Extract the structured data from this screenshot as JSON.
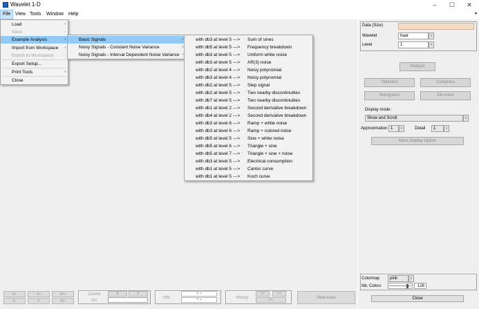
{
  "window": {
    "title": "Wavelet 1-D",
    "minimize": "–",
    "maximize": "☐",
    "close": "✕"
  },
  "menubar": {
    "items": [
      "File",
      "View",
      "Tools",
      "Window",
      "Help"
    ],
    "overflow_arrow": "▾"
  },
  "file_menu": {
    "items": [
      {
        "label": "Load",
        "disabled": false,
        "submenu": true
      },
      {
        "label": "Save",
        "disabled": true,
        "submenu": true
      },
      {
        "label": "Example Analysis",
        "disabled": false,
        "submenu": true,
        "highlighted": true
      },
      {
        "label": "Import from Workspace",
        "disabled": false,
        "submenu": true
      },
      {
        "label": "Export to Workspace",
        "disabled": true,
        "submenu": true
      },
      {
        "label": "Export Setup...",
        "disabled": false,
        "submenu": false
      },
      {
        "label": "Print Tools",
        "disabled": false,
        "submenu": true
      },
      {
        "label": "Close",
        "disabled": false,
        "submenu": false
      }
    ],
    "submenu_arrow": "›"
  },
  "example_menu": {
    "items": [
      {
        "label": "Basic Signals",
        "highlighted": true
      },
      {
        "label": "Noisy Signals - Constant Noise Variance",
        "highlighted": false
      },
      {
        "label": "Noisy Signals - Interval Dependent Noise Variance",
        "highlighted": false
      }
    ],
    "submenu_arrow": "›"
  },
  "basic_signals": [
    {
      "prefix": "with db3 at level 5 --->",
      "name": "Sum of sines"
    },
    {
      "prefix": "with db5 at level 5 --->",
      "name": "Frequency breakdown"
    },
    {
      "prefix": "with db3 at level 5 --->",
      "name": "Uniform white noise"
    },
    {
      "prefix": "with db3 at level 5 --->",
      "name": "AR(3) noise"
    },
    {
      "prefix": "with db2 at level 4 --->",
      "name": "Noisy polynomial"
    },
    {
      "prefix": "with db3 at level 4 --->",
      "name": "Noisy polynomial"
    },
    {
      "prefix": "with db2 at level 5 --->",
      "name": "Step signal"
    },
    {
      "prefix": "with db2 at level 5 --->",
      "name": "Two nearby discontinuities"
    },
    {
      "prefix": "with db7 at level 5 --->",
      "name": "Two nearby discontinuities"
    },
    {
      "prefix": "with db1 at level 2 --->",
      "name": "Second derivative breakdown"
    },
    {
      "prefix": "with db4 at level 2 --->",
      "name": "Second derivative breakdown"
    },
    {
      "prefix": "with db3 at level 6 --->",
      "name": "Ramp + white noise"
    },
    {
      "prefix": "with db3 at level 6 --->",
      "name": "Ramp + colored noise"
    },
    {
      "prefix": "with db5 at level 5 --->",
      "name": "Sine + white noise"
    },
    {
      "prefix": "with db5 at level 6 --->",
      "name": "Triangle + sine"
    },
    {
      "prefix": "with db5 at level 7 --->",
      "name": "Triangle + sine + noise"
    },
    {
      "prefix": "with db3 at level 5 --->",
      "name": "Electrical consumption"
    },
    {
      "prefix": "with db1 at level 5 --->",
      "name": "Cantor curve"
    },
    {
      "prefix": "with db1 at level 5 --->",
      "name": "Koch curve"
    }
  ],
  "right_panel": {
    "data_label": "Data  (Size)",
    "wavelet_label": "Wavelet",
    "wavelet_value": "haar",
    "level_label": "Level",
    "level_value": "1",
    "analyze": "Analyze",
    "statistics": "Statistics",
    "compress": "Compress",
    "histograms": "Histograms",
    "denoise": "De-noise",
    "display_mode_label": "Display mode :",
    "display_mode_value": "Show and Scroll",
    "approximation_label": "Approximation",
    "approximation_value": "1",
    "detail_label": "Detail",
    "detail_value": "1",
    "more_display": "More Display Option",
    "colormap_label": "Colormap",
    "colormap_value": "pink",
    "nb_colors_label": "Nb. Colors",
    "nb_colors_value": "128",
    "nb_colors_fraction": 0.85,
    "close": "Close"
  },
  "bottom_toolbar": {
    "x_plus": "X+",
    "y_plus": "Y+",
    "xy_plus": "XY+",
    "x_minus": "X-",
    "y_minus": "Y-",
    "xy_minus": "XY-",
    "center": "Center",
    "on": "On",
    "center_x": "X",
    "center_y": "Y",
    "info": "Info",
    "xeq": "X =",
    "yeq": "Y =",
    "history": "History",
    "hist_left": "<<",
    "hist_right": ">>",
    "hist_minus": "<<-",
    "view_axes": "View Axes"
  }
}
